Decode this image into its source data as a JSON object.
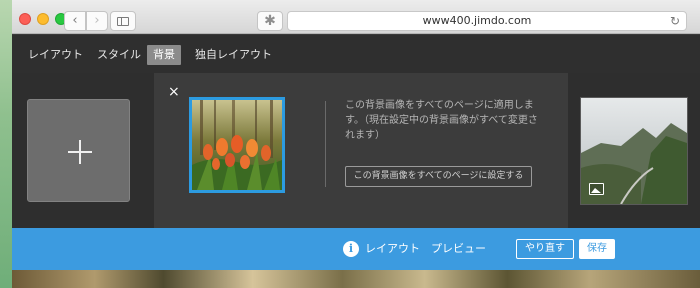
{
  "browser": {
    "url": "www400.jimdo.com",
    "back_icon": "‹",
    "forward_icon": "›",
    "extension_icon": "✱",
    "reload_icon": "↻"
  },
  "menu": {
    "items": [
      "レイアウト",
      "スタイル",
      "背景",
      "独自レイアウト"
    ],
    "active": "背景"
  },
  "background_panel": {
    "add_label": "+",
    "close_label": "×",
    "apply_all_text": "この背景画像をすべてのページに適用します。（現在設定中の背景画像がすべて変更されます）",
    "apply_all_button": "この背景画像をすべてのページに設定する"
  },
  "preview_bar": {
    "info_icon": "i",
    "label": "レイアウト　プレビュー",
    "redo_button": "やり直す",
    "save_button": "保存"
  },
  "colors": {
    "accent_blue": "#3c9be0",
    "menu_dark": "#2f2f2f",
    "panel_dark": "#3c3c3c"
  }
}
